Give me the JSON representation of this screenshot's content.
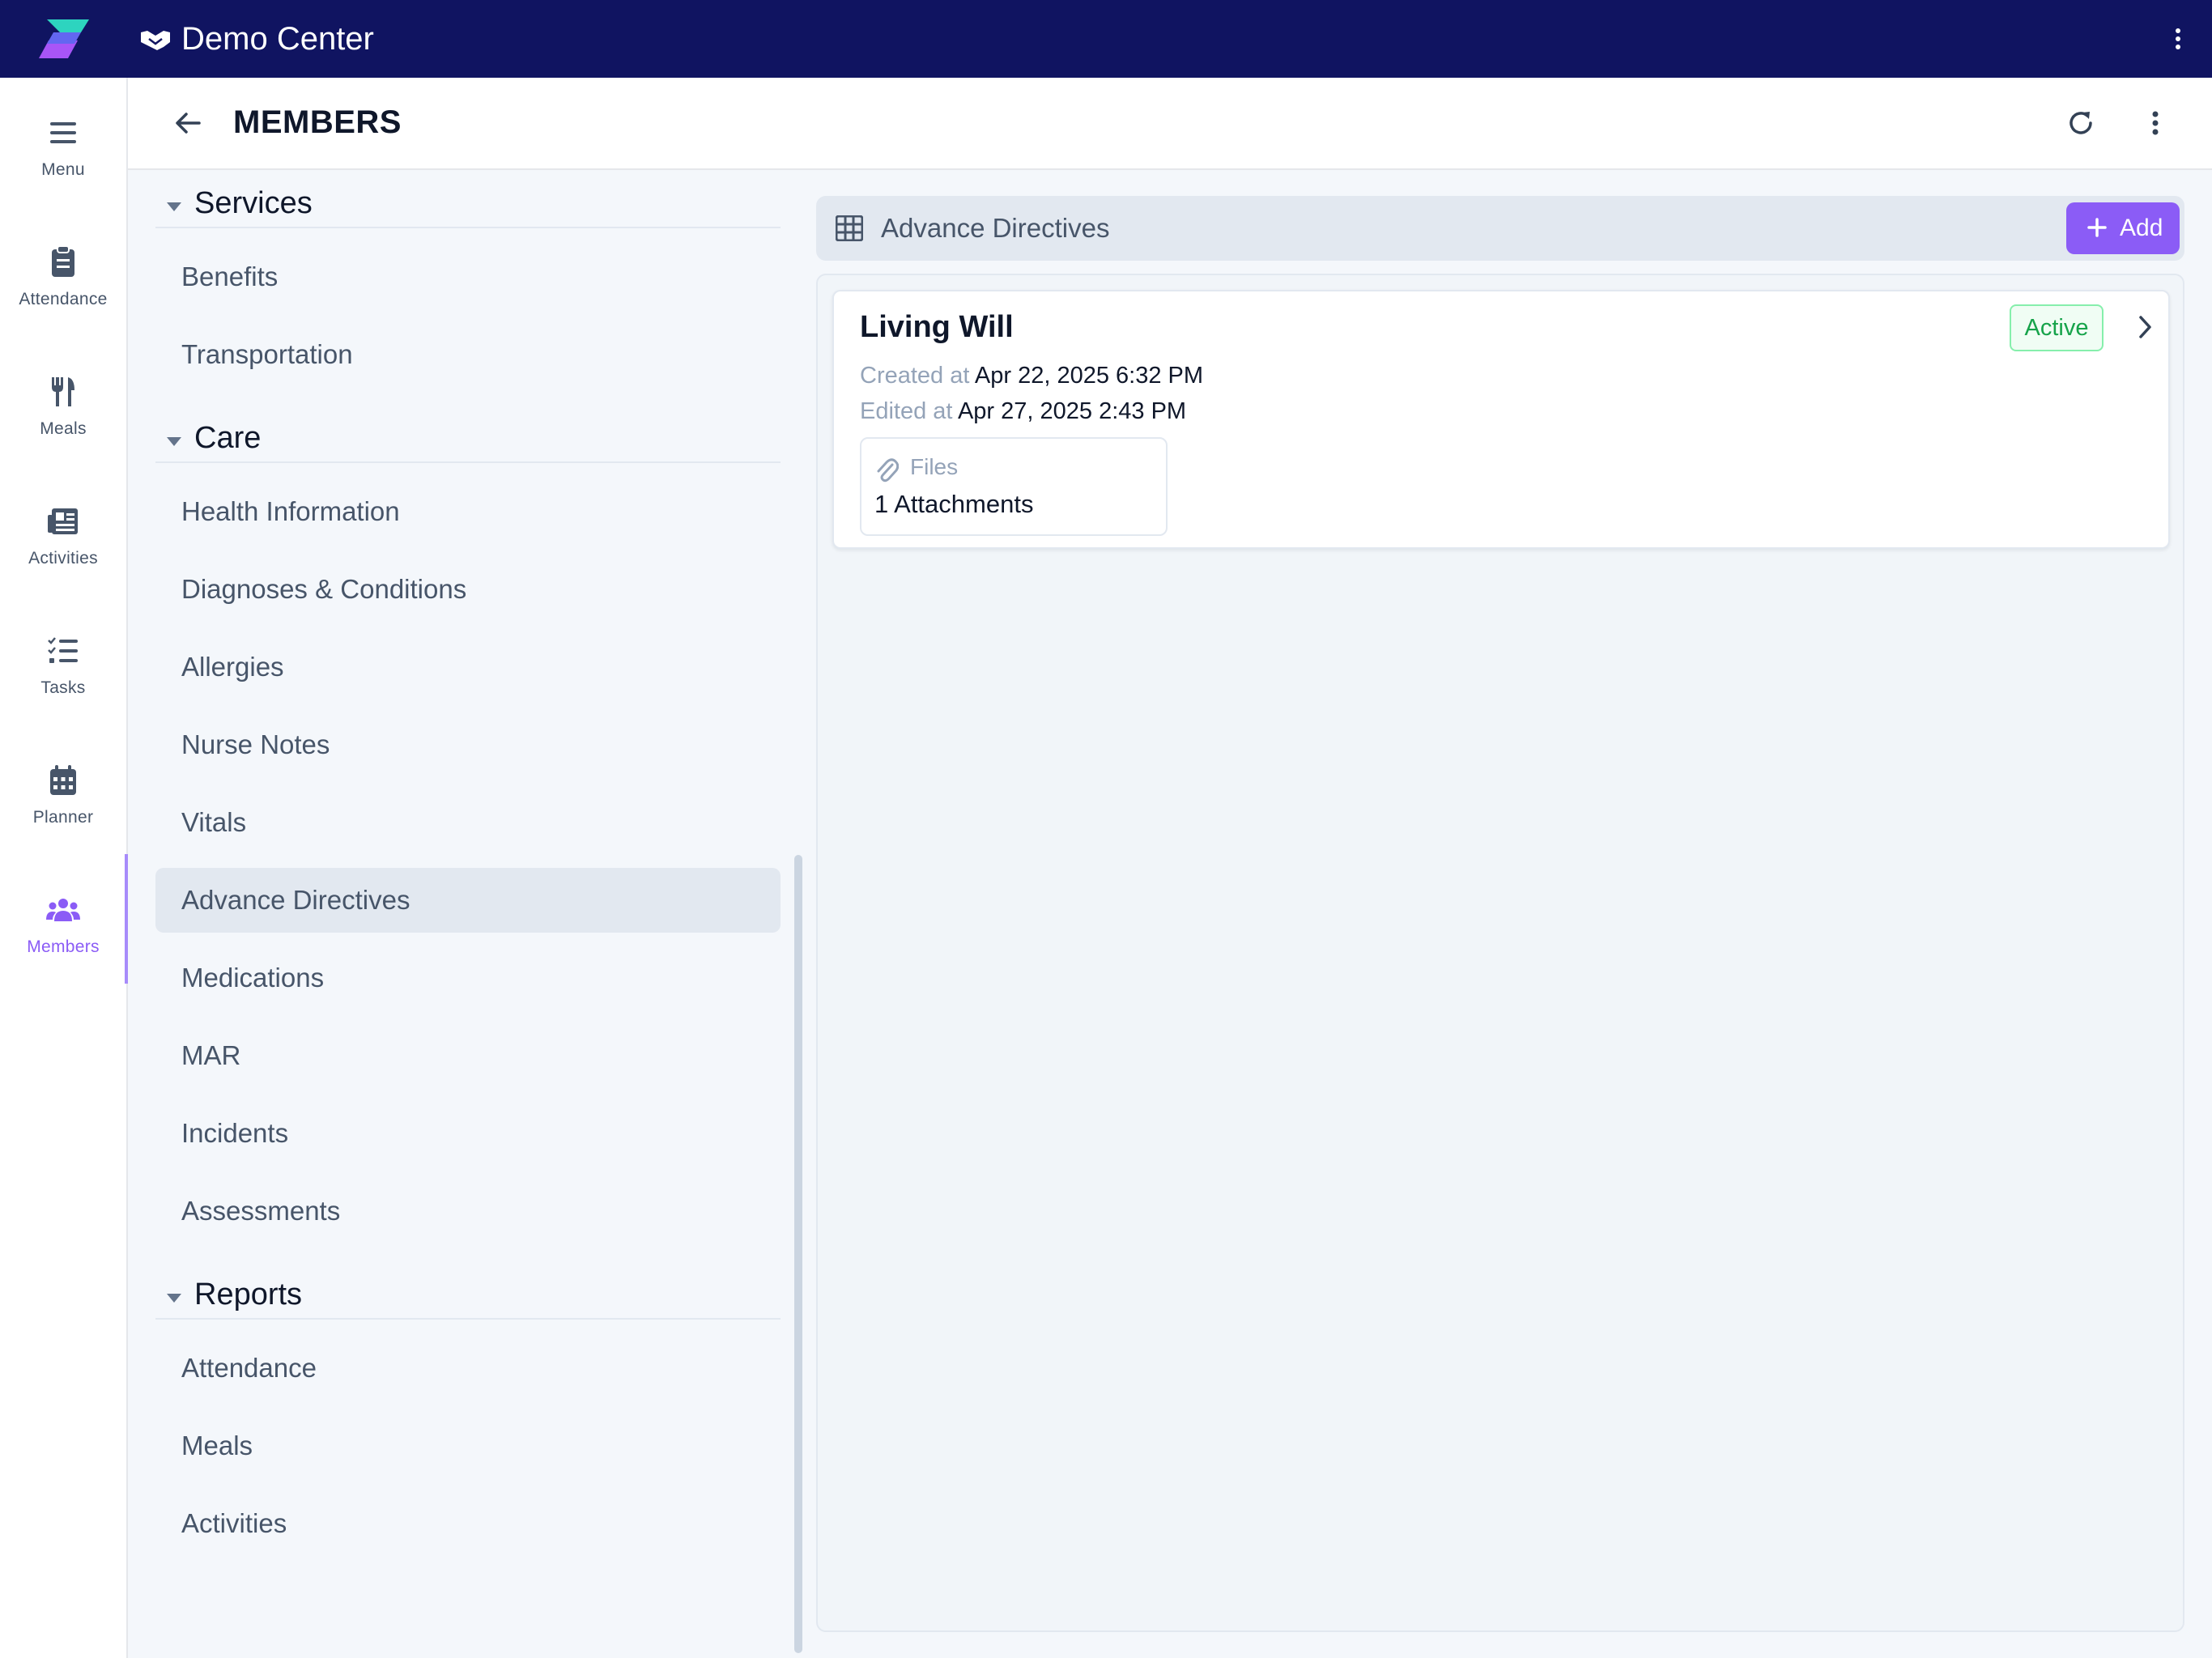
{
  "app": {
    "org_name": "Demo Center",
    "brand_color": "#101461",
    "accent_color": "#8b5cf6"
  },
  "rail": {
    "items": [
      {
        "label": "Menu",
        "icon": "hamburger-icon"
      },
      {
        "label": "Attendance",
        "icon": "clipboard-icon"
      },
      {
        "label": "Meals",
        "icon": "utensils-icon"
      },
      {
        "label": "Activities",
        "icon": "newspaper-icon"
      },
      {
        "label": "Tasks",
        "icon": "checklist-icon"
      },
      {
        "label": "Planner",
        "icon": "calendar-icon"
      },
      {
        "label": "Members",
        "icon": "users-icon",
        "active": true
      }
    ]
  },
  "header": {
    "title": "MEMBERS"
  },
  "nav": {
    "services": {
      "label": "Services",
      "items": [
        "Benefits",
        "Transportation"
      ]
    },
    "care": {
      "label": "Care",
      "items": [
        "Health Information",
        "Diagnoses & Conditions",
        "Allergies",
        "Nurse Notes",
        "Vitals",
        "Advance Directives",
        "Medications",
        "MAR",
        "Incidents",
        "Assessments"
      ],
      "selected": "Advance Directives"
    },
    "reports": {
      "label": "Reports",
      "items": [
        "Attendance",
        "Meals",
        "Activities"
      ]
    }
  },
  "main": {
    "section_title": "Advance Directives",
    "add_label": "Add",
    "record": {
      "title": "Living Will",
      "status": "Active",
      "created_label": "Created at",
      "created_value": "Apr 22, 2025 6:32 PM",
      "edited_label": "Edited at",
      "edited_value": "Apr 27, 2025 2:43 PM",
      "files_label": "Files",
      "files_value": "1 Attachments"
    }
  }
}
